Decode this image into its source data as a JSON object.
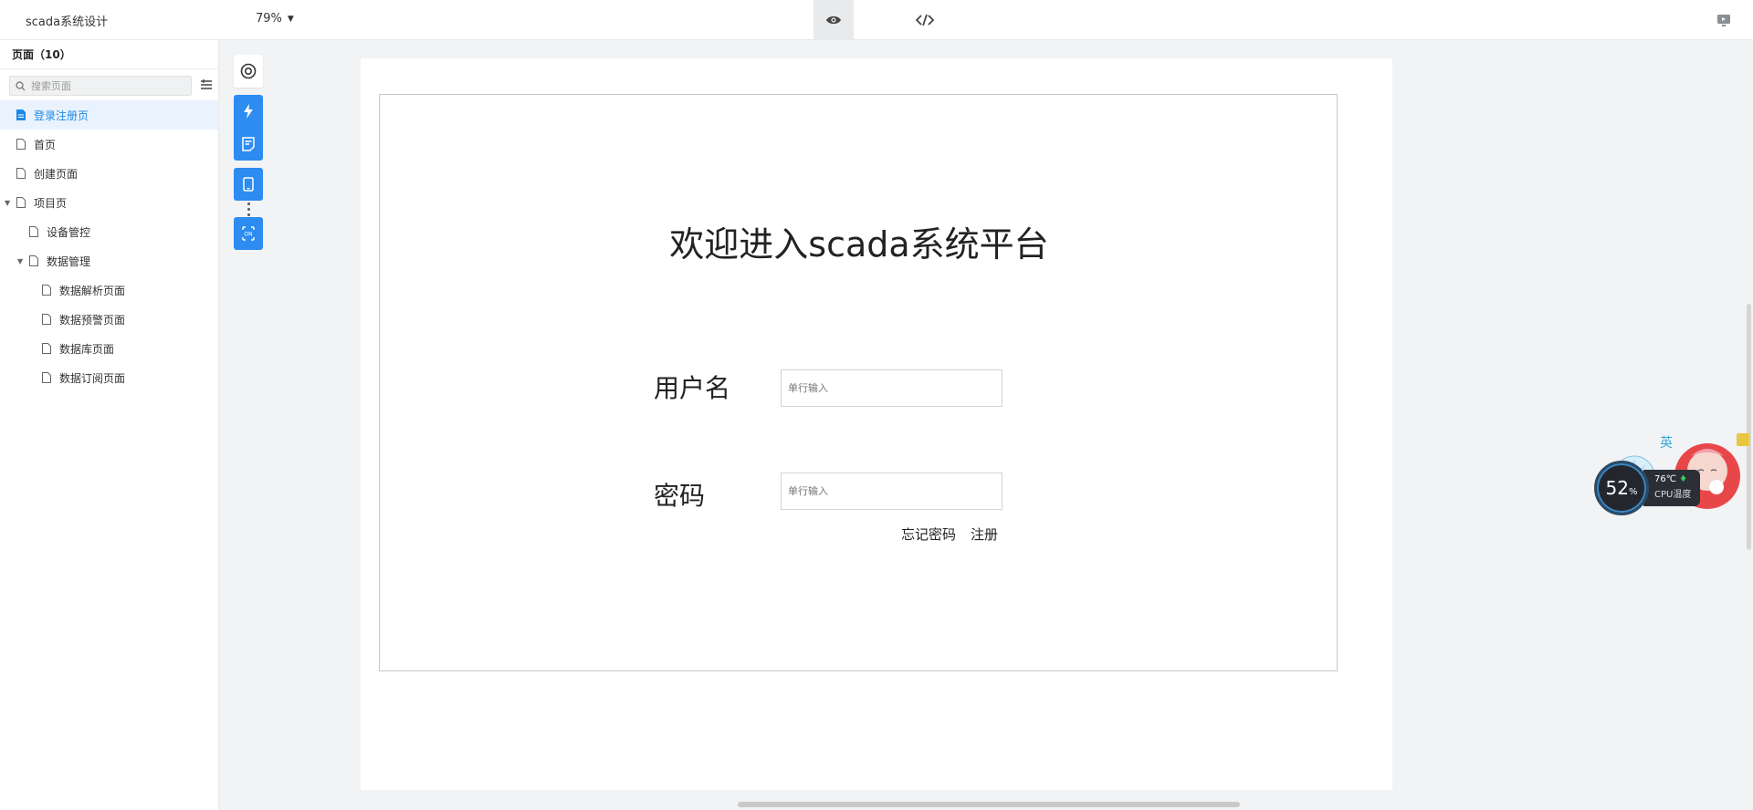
{
  "app": {
    "title": "scada系统设计",
    "zoom": "79%"
  },
  "toolbar": {
    "modes": [
      {
        "name": "preview-mode",
        "icon": "eye-icon",
        "active": true
      },
      {
        "name": "code-mode",
        "icon": "code-icon",
        "active": false
      }
    ],
    "preview_icon": "monitor-icon"
  },
  "sidebar": {
    "title": "页面（10）",
    "search_placeholder": "搜索页面",
    "items": [
      {
        "label": "登录注册页",
        "level": 0,
        "selected": true,
        "expandable": false
      },
      {
        "label": "首页",
        "level": 0,
        "selected": false,
        "expandable": false
      },
      {
        "label": "创建页面",
        "level": 0,
        "selected": false,
        "expandable": false
      },
      {
        "label": "项目页",
        "level": 0,
        "selected": false,
        "expandable": true
      },
      {
        "label": "设备管控",
        "level": 1,
        "selected": false,
        "expandable": false
      },
      {
        "label": "数据管理",
        "level": 1,
        "selected": false,
        "expandable": true
      },
      {
        "label": "数据解析页面",
        "level": 2,
        "selected": false,
        "expandable": false
      },
      {
        "label": "数据预警页面",
        "level": 2,
        "selected": false,
        "expandable": false
      },
      {
        "label": "数据库页面",
        "level": 2,
        "selected": false,
        "expandable": false
      },
      {
        "label": "数据订阅页面",
        "level": 2,
        "selected": false,
        "expandable": false
      }
    ]
  },
  "vertical_tools": [
    {
      "name": "target-icon"
    },
    {
      "name": "lightning-icon"
    },
    {
      "name": "note-icon"
    },
    {
      "name": "mobile-icon"
    },
    {
      "name": "toggle-on-icon"
    }
  ],
  "canvas": {
    "welcome": "欢迎进入scada系统平台",
    "username_label": "用户名",
    "username_placeholder": "单行输入",
    "password_label": "密码",
    "password_placeholder": "单行输入",
    "forgot_link": "忘记密码",
    "register_link": "注册"
  },
  "cpu_widget": {
    "usage": "52",
    "usage_unit": "%",
    "temperature": "76℃",
    "label": "CPU温度"
  },
  "colors": {
    "accent": "#2d8cf0",
    "selected_text": "#1e88e5",
    "selected_bg": "#eaf3fd"
  }
}
